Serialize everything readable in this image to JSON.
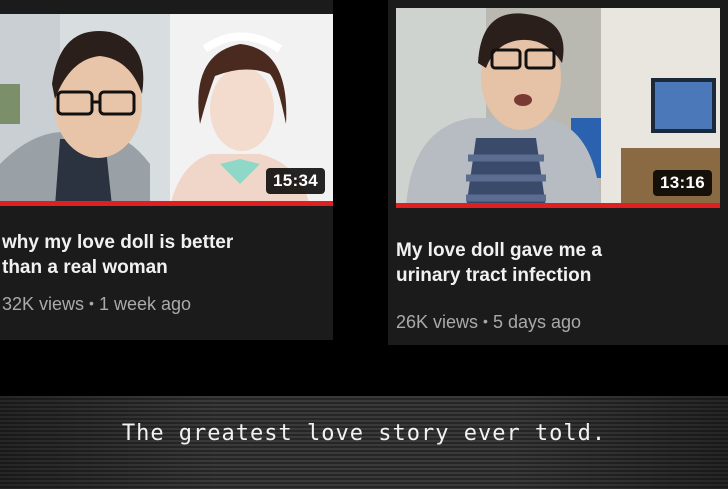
{
  "videos": [
    {
      "title": "why my love doll is better\nthan a real woman",
      "views": "32K views",
      "age": "1 week ago",
      "duration": "15:34",
      "separator": "•"
    },
    {
      "title": "My love doll gave me a\nurinary tract infection",
      "views": "26K views",
      "age": "5 days ago",
      "duration": "13:16",
      "separator": "•"
    }
  ],
  "caption": "The greatest love story ever told.",
  "colors": {
    "progress": "#e02020",
    "card": "#1b1b1b",
    "meta_text": "#aaaaaa"
  }
}
